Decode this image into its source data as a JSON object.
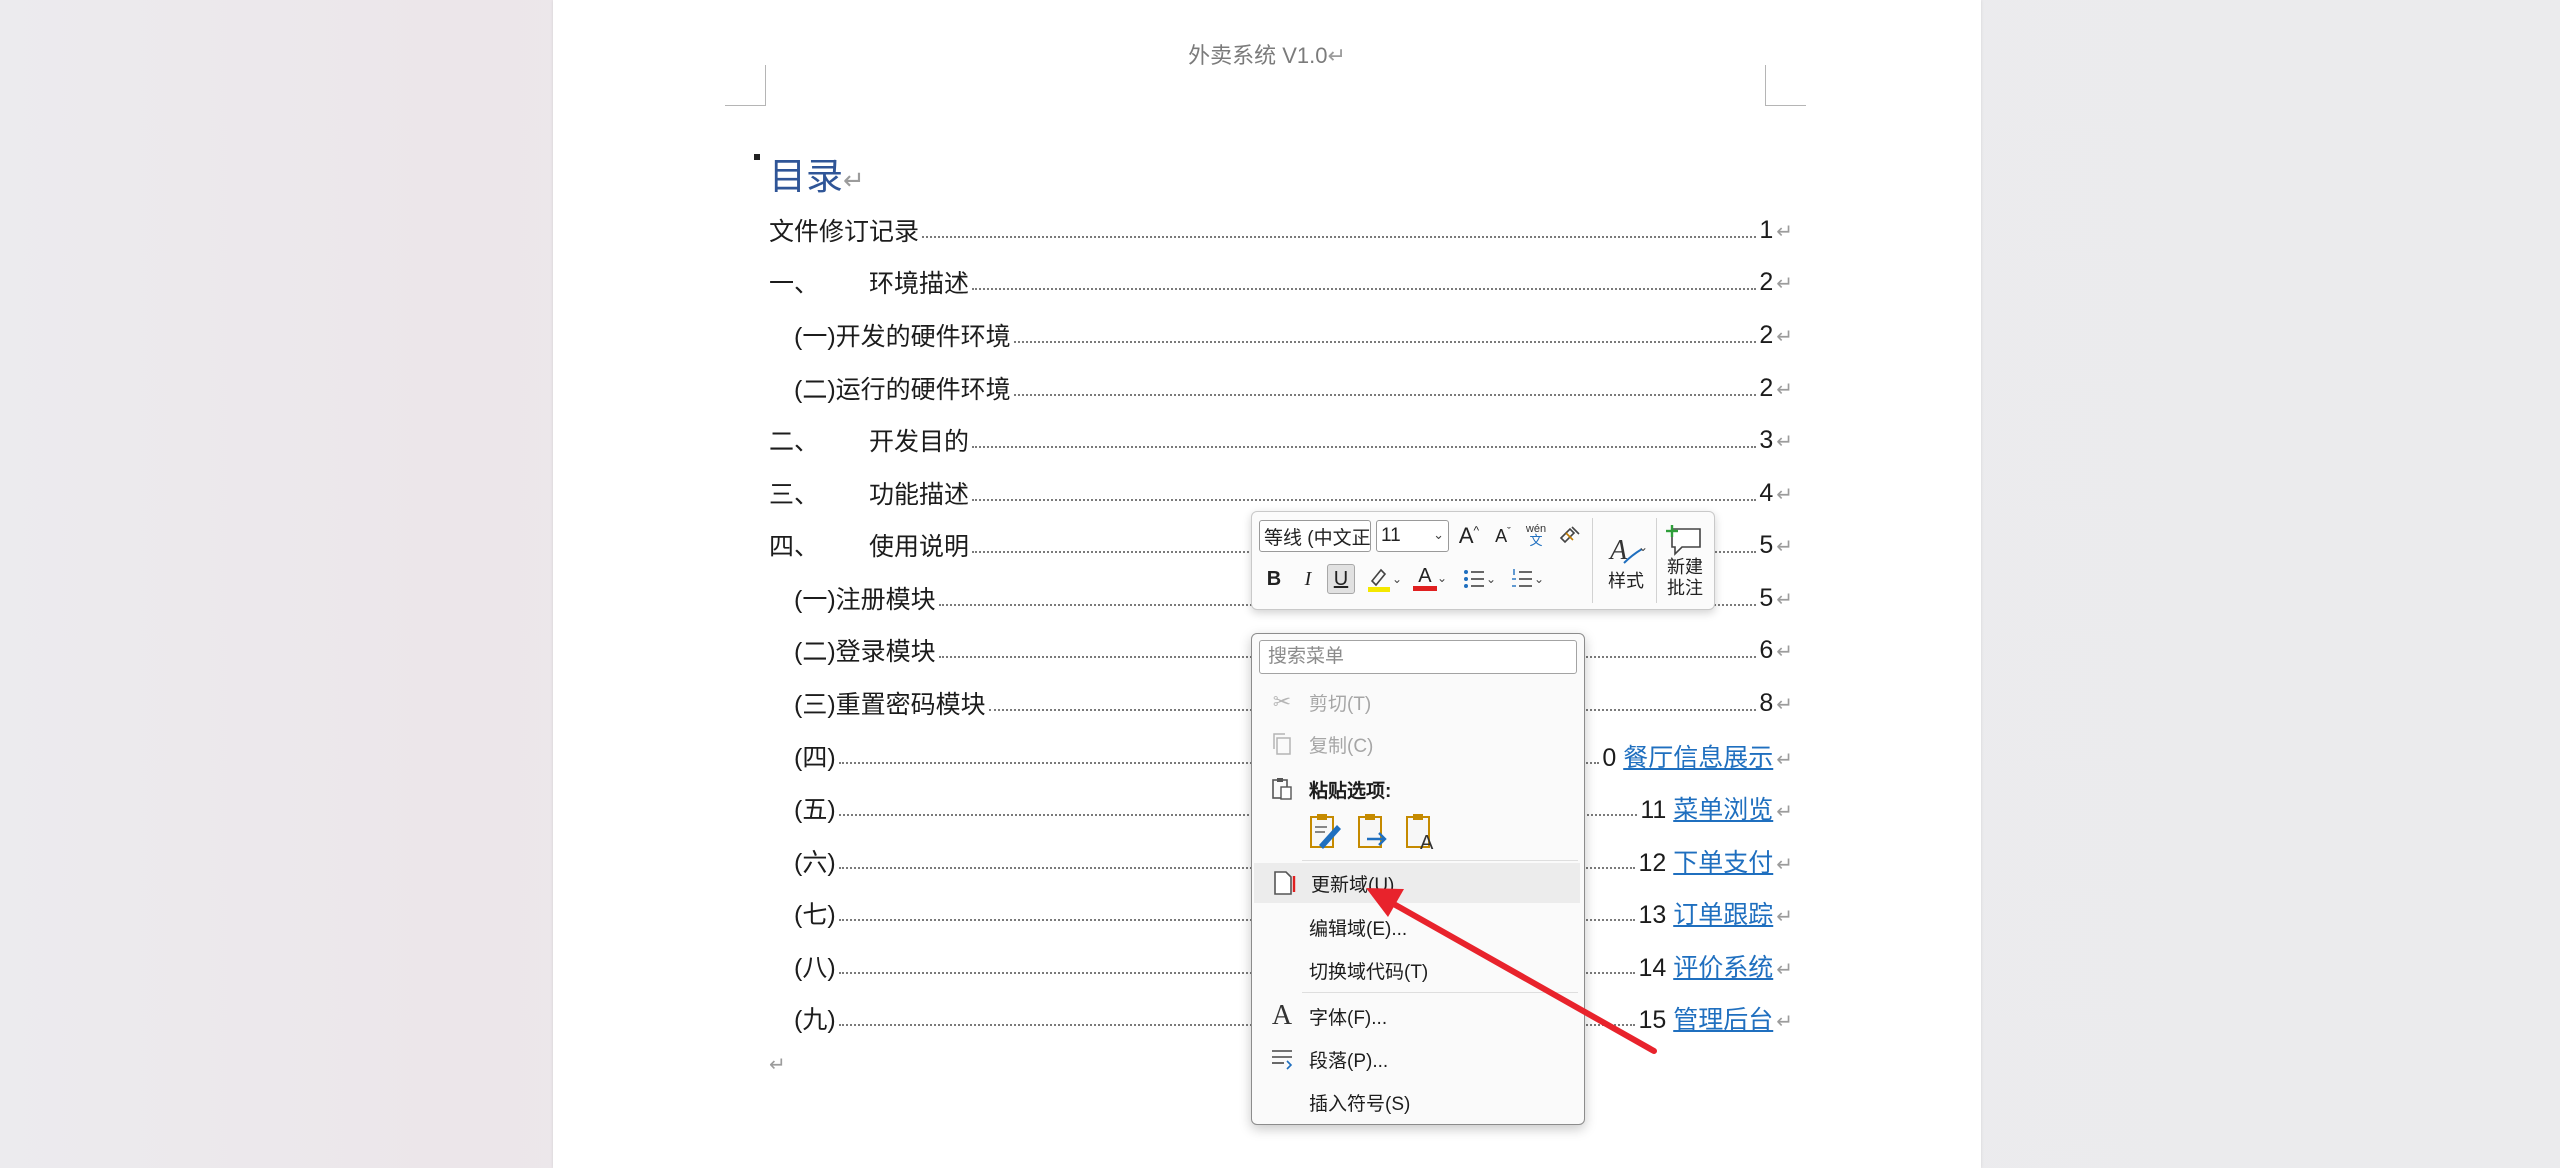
{
  "header": {
    "text": "外卖系统 V1.0"
  },
  "toc": {
    "heading": "目录",
    "entries": [
      {
        "num": "",
        "title": "文件修订记录",
        "page": "1",
        "link": ""
      },
      {
        "num": "一、",
        "title": "环境描述",
        "page": "2",
        "link": ""
      },
      {
        "num": "",
        "title": "(一)开发的硬件环境",
        "page": "2",
        "link": ""
      },
      {
        "num": "",
        "title": "(二)运行的硬件环境",
        "page": "2",
        "link": ""
      },
      {
        "num": "二、",
        "title": "开发目的",
        "page": "3",
        "link": ""
      },
      {
        "num": "三、",
        "title": "功能描述",
        "page": "4",
        "link": ""
      },
      {
        "num": "四、",
        "title": "使用说明",
        "page": "5",
        "link": ""
      },
      {
        "num": "",
        "title": "(一)注册模块",
        "page": "5",
        "link": ""
      },
      {
        "num": "",
        "title": "(二)登录模块",
        "page": "6",
        "link": ""
      },
      {
        "num": "",
        "title": "(三)重置密码模块",
        "page": "8",
        "link": ""
      },
      {
        "num": "",
        "title": "(四)",
        "page": "0",
        "link": "餐厅信息展示"
      },
      {
        "num": "",
        "title": "(五)",
        "page": "11",
        "link": "菜单浏览"
      },
      {
        "num": "",
        "title": "(六)",
        "page": "12",
        "link": "下单支付"
      },
      {
        "num": "",
        "title": "(七)",
        "page": "13",
        "link": "订单跟踪"
      },
      {
        "num": "",
        "title": "(八)",
        "page": "14",
        "link": "评价系统"
      },
      {
        "num": "",
        "title": "(九)",
        "page": "15",
        "link": "管理后台"
      }
    ]
  },
  "mini_toolbar": {
    "font_name": "等线 (中文正",
    "font_size": "11",
    "grow_font": "A",
    "shrink_font": "A",
    "phonetic_top": "wén",
    "phonetic_bottom": "文",
    "bold": "B",
    "italic": "I",
    "underline": "U",
    "font_color_letter": "A",
    "styles_label": "样式",
    "new_comment_line1": "新建",
    "new_comment_line2": "批注",
    "highlight_color": "#f4e800",
    "font_color": "#e02020"
  },
  "context_menu": {
    "search_placeholder": "搜索菜单",
    "cut": "剪切(T)",
    "copy": "复制(C)",
    "paste_options": "粘贴选项:",
    "update_field": "更新域(U)",
    "edit_field": "编辑域(E)...",
    "toggle_field_codes": "切换域代码(T)",
    "font": "字体(F)...",
    "paragraph": "段落(P)...",
    "insert_symbol": "插入符号(S)",
    "font_icon": "A"
  },
  "annotation": {
    "arrow_color": "#e8232c"
  }
}
